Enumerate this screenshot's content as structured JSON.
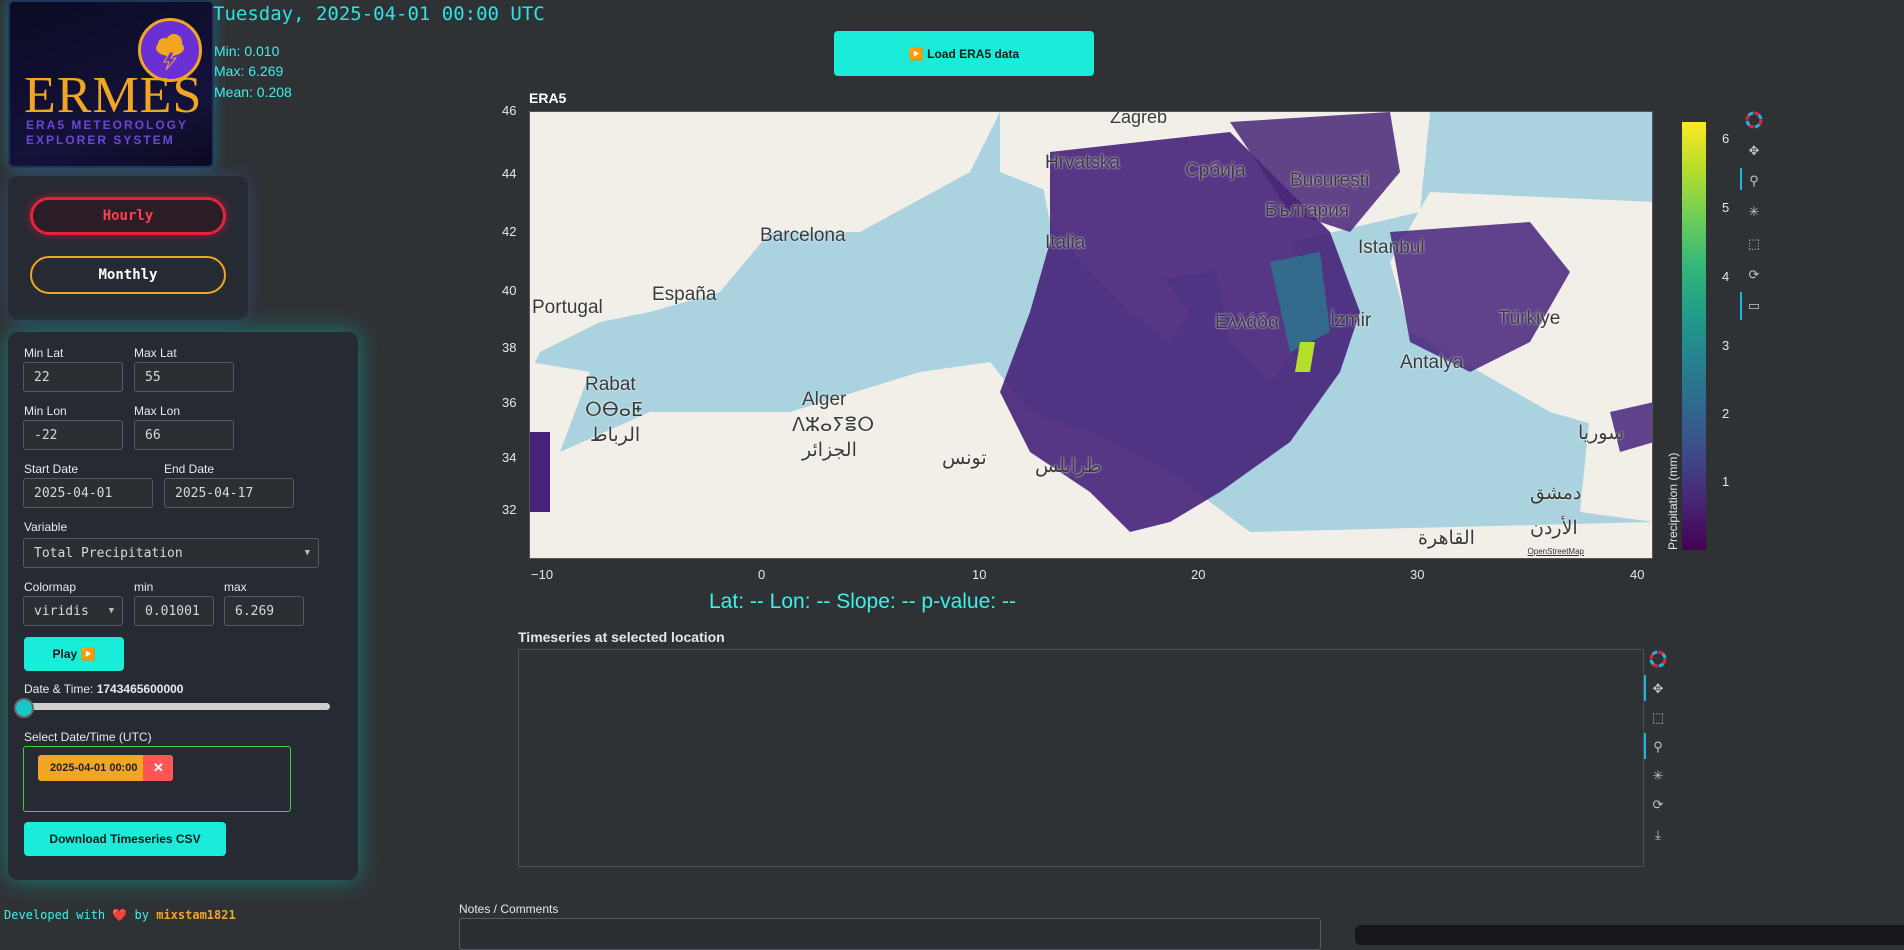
{
  "logo": {
    "brand": "ERMES",
    "tagline_line1": "ERA5 METEOROLOGY",
    "tagline_line2": "EXPLORER SYSTEM"
  },
  "header": {
    "datetime": "Tuesday, 2025-04-01 00:00 UTC",
    "min": "Min: 0.010",
    "max": "Max: 6.269",
    "mean": "Mean: 0.208"
  },
  "mode": {
    "hourly": "Hourly",
    "monthly": "Monthly",
    "active": "Hourly"
  },
  "controls": {
    "min_lat_label": "Min Lat",
    "min_lat": "22",
    "max_lat_label": "Max Lat",
    "max_lat": "55",
    "min_lon_label": "Min Lon",
    "min_lon": "-22",
    "max_lon_label": "Max Lon",
    "max_lon": "66",
    "start_date_label": "Start Date",
    "start_date": "2025-04-01",
    "end_date_label": "End Date",
    "end_date": "2025-04-17",
    "variable_label": "Variable",
    "variable": "Total Precipitation",
    "colormap_label": "Colormap",
    "colormap": "viridis",
    "cmin_label": "min",
    "cmin": "0.01001",
    "cmax_label": "max",
    "cmax": "6.269",
    "play": "Play ▶️",
    "slider_label": "Date & Time:",
    "slider_value": "1743465600000",
    "slider_fraction": 0,
    "select_dt_label": "Select Date/Time (UTC)",
    "selected_chip": "2025-04-01 00:00",
    "chip_close": "✕",
    "download": "Download Timeseries CSV"
  },
  "footer": {
    "text": "Developed with ❤️ by",
    "author": "mixstam1821"
  },
  "load_button": "▶️ Load ERA5 data",
  "map": {
    "title": "ERA5",
    "attribution": "OpenStreetMap",
    "lat_ticks": [
      "46",
      "44",
      "42",
      "40",
      "38",
      "36",
      "34",
      "32"
    ],
    "lon_ticks": [
      "−10",
      "0",
      "10",
      "20",
      "30",
      "40"
    ],
    "places": {
      "zagreb": "Zagreb",
      "hrvatska": "Hrvatska",
      "srbija": "Србија",
      "bucuresti": "București",
      "bulgaria": "България",
      "barcelona": "Barcelona",
      "italia": "Italia",
      "istanbul": "Istanbul",
      "espana": "España",
      "portugal": "Portugal",
      "ellada": "Ελλάδα",
      "izmir": "İzmir",
      "turkiye": "Türkiye",
      "antalya": "Antalya",
      "rabat": "Rabat",
      "rabat_tifinagh": "ⵔⴱⴰⵟ",
      "rabat_arabic": "الرباط",
      "alger": "Alger",
      "alger_tifinagh": "ⴷⵣⴰⵢⴻⵔ",
      "alger_arabic": "الجزائر",
      "tunis": "تونس",
      "tripoli": "طرابلس",
      "syria": "سوريا",
      "damascus": "دمشق",
      "jordan": "الأردن",
      "cairo": "القاهرة"
    }
  },
  "colorbar": {
    "colormap": "viridis",
    "ticks": [
      "6",
      "5",
      "4",
      "3",
      "2",
      "1"
    ],
    "label": "Precipitation (mm)",
    "range": [
      0.01001,
      6.269
    ]
  },
  "status": "Lat: -- Lon: -- Slope: -- p-value: --",
  "timeseries": {
    "title": "Timeseries at selected location"
  },
  "notes": {
    "label": "Notes / Comments"
  },
  "colors": {
    "accent": "#19ecd9",
    "orange": "#f0a623",
    "red": "#e8213d",
    "bg": "#2f3235"
  }
}
